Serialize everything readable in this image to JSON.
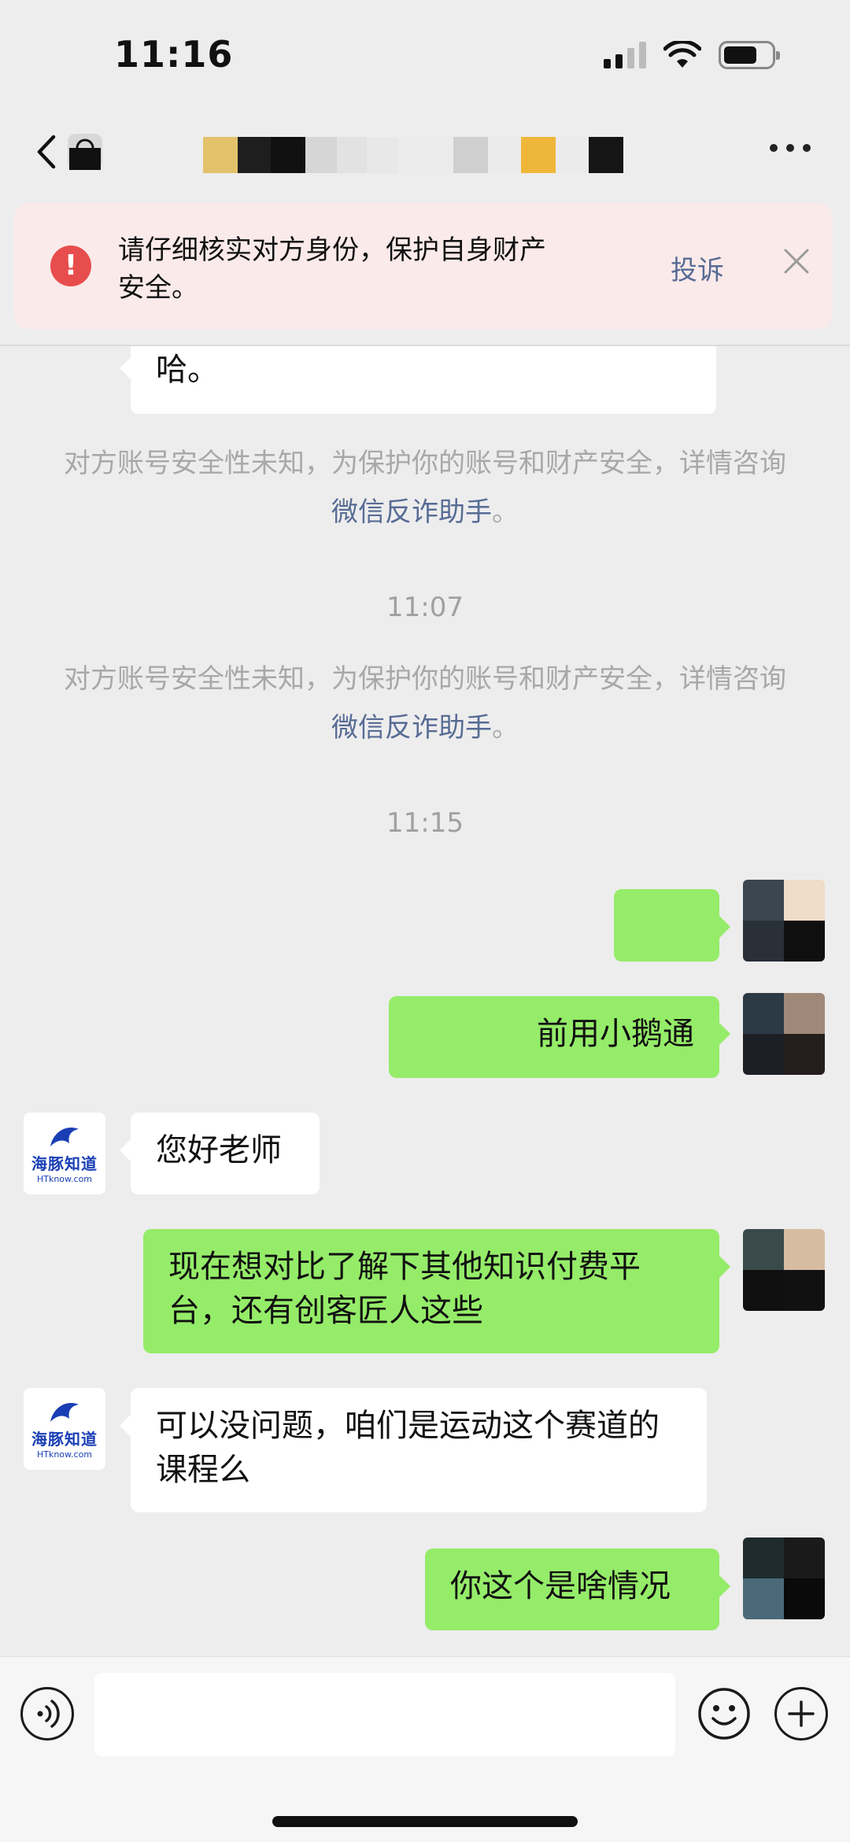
{
  "status_bar": {
    "time": "11:16"
  },
  "banner": {
    "warning_text": "请仔细核实对方身份，保护自身财产安全。",
    "report_label": "投诉",
    "icon": "exclamation-circle-icon",
    "colors": {
      "background": "#fbeaea",
      "icon": "#e84d4d",
      "link": "#576b95"
    }
  },
  "messages": [
    {
      "type": "incoming",
      "text": "哈。"
    },
    {
      "type": "notice",
      "text": "对方账号安全性未知，为保护你的账号和财产安全，详情咨询",
      "link": "微信反诈助手",
      "suffix": "。"
    },
    {
      "type": "time",
      "text": "11:07"
    },
    {
      "type": "notice",
      "text": "对方账号安全性未知，为保护你的账号和财产安全，详情咨询",
      "link": "微信反诈助手",
      "suffix": "。"
    },
    {
      "type": "time",
      "text": "11:15"
    },
    {
      "type": "outgoing",
      "text": ""
    },
    {
      "type": "outgoing",
      "text": "前用小鹅通"
    },
    {
      "type": "incoming",
      "text": "您好老师"
    },
    {
      "type": "outgoing",
      "text": "现在想对比了解下其他知识付费平台，还有创客匠人这些"
    },
    {
      "type": "incoming",
      "text": "可以没问题，咱们是运动这个赛道的课程么"
    },
    {
      "type": "outgoing",
      "text": "你这个是啥情况"
    }
  ],
  "contact_avatar": {
    "logo_text": "海豚知道",
    "logo_sub": "HTknow.com"
  },
  "input_bar": {
    "placeholder": ""
  },
  "colors": {
    "chat_background": "#ededed",
    "outgoing_bubble": "#95ec69",
    "incoming_bubble": "#ffffff"
  }
}
